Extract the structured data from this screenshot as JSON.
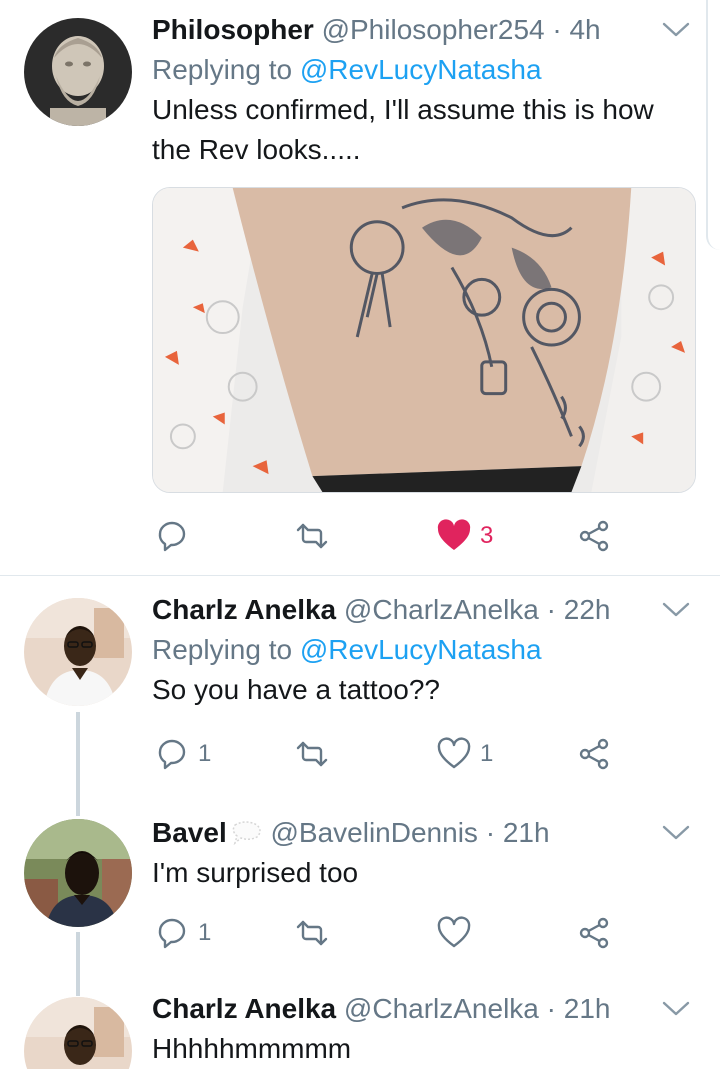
{
  "tweets": [
    {
      "name": "Philosopher",
      "handle": "@Philosopher254",
      "dot": "·",
      "time": "4h",
      "reply_prefix": "Replying to ",
      "reply_to": "@RevLucyNatasha",
      "text_line1": "Unless confirmed, I'll assume this is how",
      "text_line2": "the Rev looks.....",
      "reply_count": "",
      "retweet_count": "",
      "like_count": "3",
      "liked": true
    },
    {
      "name": "Charlz Anelka",
      "handle": "@CharlzAnelka",
      "dot": "·",
      "time": "22h",
      "reply_prefix": "Replying to ",
      "reply_to": "@RevLucyNatasha",
      "text": "So you have a tattoo??",
      "reply_count": "1",
      "retweet_count": "",
      "like_count": "1"
    },
    {
      "name": "Bavel",
      "handle": "@BavelinDennis",
      "dot": "·",
      "time": "21h",
      "text": "I'm surprised too",
      "reply_count": "1",
      "retweet_count": "",
      "like_count": ""
    },
    {
      "name": "Charlz Anelka",
      "handle": "@CharlzAnelka",
      "dot": "·",
      "time": "21h",
      "text": "Hhhhhmmmmm"
    }
  ],
  "colors": {
    "accent": "#1da1f2",
    "like_active": "#e0245e",
    "secondary_text": "#657786",
    "divider": "#e1e8ed"
  },
  "icons": {
    "reply": "reply-icon",
    "retweet": "retweet-icon",
    "like": "heart-icon",
    "share": "share-icon",
    "more": "chevron-down-icon"
  }
}
